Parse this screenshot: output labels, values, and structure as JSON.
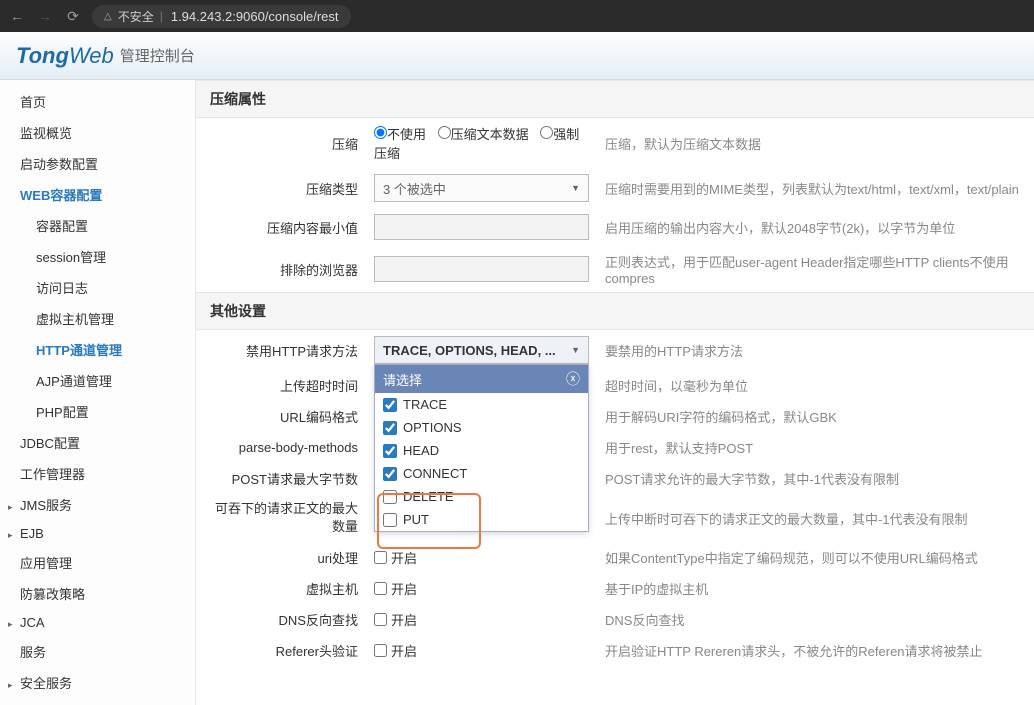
{
  "browser": {
    "insecure_label": "不安全",
    "url": "1.94.243.2:9060/console/rest"
  },
  "header": {
    "logo1": "Tong",
    "logo2": "Web",
    "subtitle": "管理控制台"
  },
  "sidebar": {
    "items": [
      {
        "label": "首页",
        "level": 1
      },
      {
        "label": "监视概览",
        "level": 1
      },
      {
        "label": "启动参数配置",
        "level": 1
      },
      {
        "label": "WEB容器配置",
        "level": 1,
        "active": true
      },
      {
        "label": "容器配置",
        "level": 2
      },
      {
        "label": "session管理",
        "level": 2
      },
      {
        "label": "访问日志",
        "level": 2
      },
      {
        "label": "虚拟主机管理",
        "level": 2
      },
      {
        "label": "HTTP通道管理",
        "level": 2,
        "active": true
      },
      {
        "label": "AJP通道管理",
        "level": 2
      },
      {
        "label": "PHP配置",
        "level": 2
      },
      {
        "label": "JDBC配置",
        "level": 1
      },
      {
        "label": "工作管理器",
        "level": 1
      },
      {
        "label": "JMS服务",
        "level": 1,
        "arrow": true
      },
      {
        "label": "EJB",
        "level": 1,
        "arrow": true
      },
      {
        "label": "应用管理",
        "level": 1
      },
      {
        "label": "防篡改策略",
        "level": 1
      },
      {
        "label": "JCA",
        "level": 1,
        "arrow": true
      },
      {
        "label": "服务",
        "level": 1
      },
      {
        "label": "安全服务",
        "level": 1,
        "arrow": true
      }
    ]
  },
  "sections": {
    "compress": "压缩属性",
    "other": "其他设置"
  },
  "compress": {
    "r1_lbl": "压缩",
    "r1_opt1": "不使用",
    "r1_opt2": "压缩文本数据",
    "r1_opt3": "强制压缩",
    "r1_desc": "压缩，默认为压缩文本数据",
    "r2_lbl": "压缩类型",
    "r2_sel": "3 个被选中",
    "r2_desc": "压缩时需要用到的MIME类型，列表默认为text/html，text/xml，text/plain",
    "r3_lbl": "压缩内容最小值",
    "r3_desc": "启用压缩的输出内容大小，默认2048字节(2k)，以字节为单位",
    "r4_lbl": "排除的浏览器",
    "r4_desc": "正则表达式，用于匹配user-agent Header指定哪些HTTP clients不使用compres"
  },
  "other": {
    "r1_lbl": "禁用HTTP请求方法",
    "r1_sel": "TRACE, OPTIONS, HEAD, ...",
    "r1_desc": "要禁用的HTTP请求方法",
    "dd_hd": "请选择",
    "dd_opts": [
      {
        "label": "TRACE",
        "checked": true
      },
      {
        "label": "OPTIONS",
        "checked": true
      },
      {
        "label": "HEAD",
        "checked": true
      },
      {
        "label": "CONNECT",
        "checked": true
      },
      {
        "label": "DELETE",
        "checked": false
      },
      {
        "label": "PUT",
        "checked": false
      }
    ],
    "r2_lbl": "上传超时时间",
    "r2_desc": "超时时间，以毫秒为单位",
    "r3_lbl": "URL编码格式",
    "r3_desc": "用于解码URI字符的编码格式，默认GBK",
    "r4_lbl": "parse-body-methods",
    "r4_desc": "用于rest，默认支持POST",
    "r5_lbl": "POST请求最大字节数",
    "r5_desc": "POST请求允许的最大字节数，其中-1代表没有限制",
    "r6_lbl1": "可吞下的请求正文的最大",
    "r6_lbl2": "数量",
    "r6_desc": "上传中断时可吞下的请求正文的最大数量，其中-1代表没有限制",
    "r7_lbl": "uri处理",
    "r7_chk": "开启",
    "r7_desc": "如果ContentType中指定了编码规范，则可以不使用URL编码格式",
    "r8_lbl": "虚拟主机",
    "r8_chk": "开启",
    "r8_desc": "基于IP的虚拟主机",
    "r9_lbl": "DNS反向查找",
    "r9_chk": "开启",
    "r9_desc": "DNS反向查找",
    "r10_lbl": "Referer头验证",
    "r10_chk": "开启",
    "r10_desc": "开启验证HTTP Rereren请求头，不被允许的Referen请求将被禁止"
  }
}
